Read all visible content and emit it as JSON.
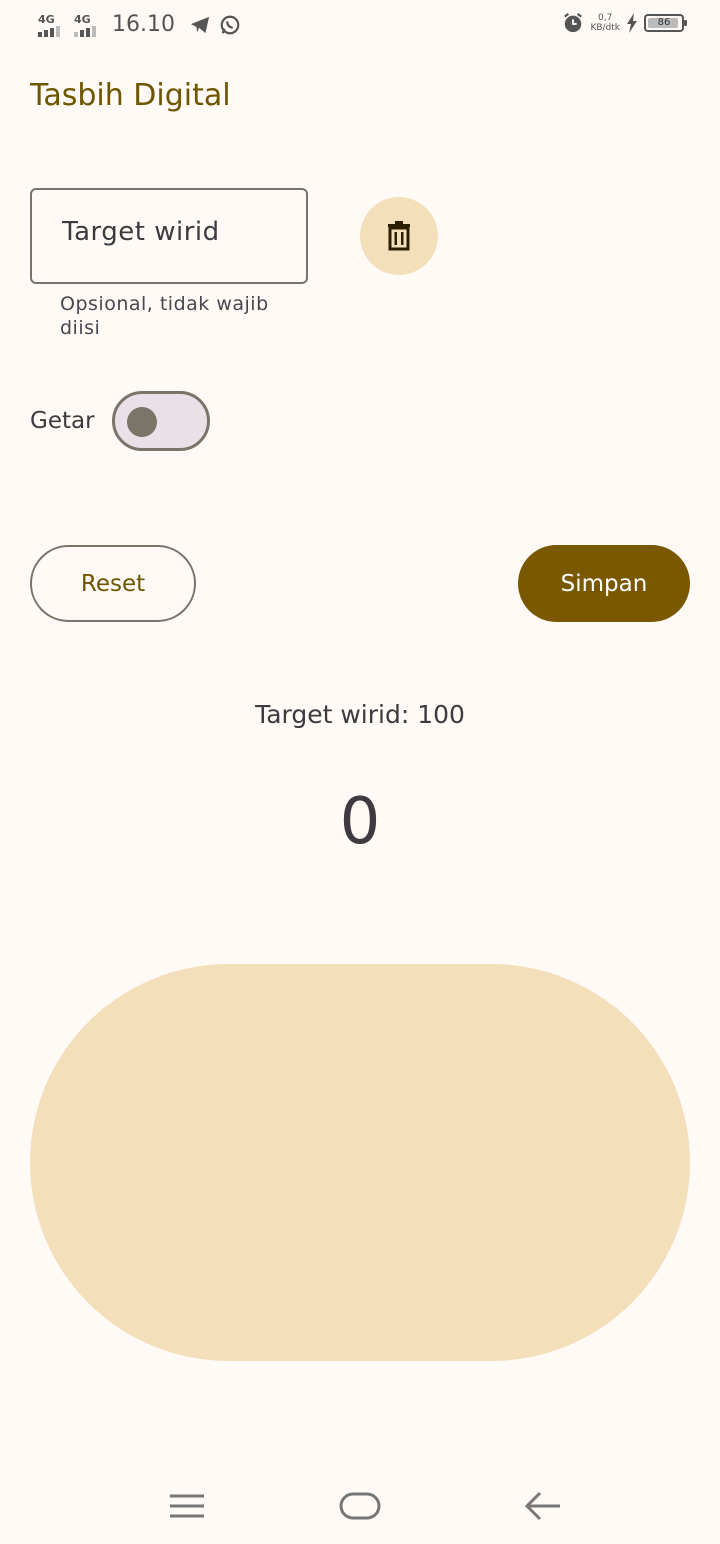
{
  "status_bar": {
    "network_1": "4G",
    "network_2": "4G",
    "time": "16.10",
    "speed_value": "0,7",
    "speed_unit": "KB/dtk",
    "battery": "86",
    "icons": [
      "telegram-icon",
      "whatsapp-icon",
      "alarm-icon",
      "charging-icon"
    ]
  },
  "app": {
    "title": "Tasbih Digital"
  },
  "form": {
    "target_placeholder": "Target wirid",
    "target_value": "",
    "helper_text": "Opsional, tidak wajib diisi",
    "vibrate_label": "Getar",
    "vibrate_on": false
  },
  "actions": {
    "reset_label": "Reset",
    "save_label": "Simpan"
  },
  "counter": {
    "target_text": "Target wirid: 100",
    "count": "0"
  },
  "colors": {
    "primary": "#7a5800",
    "title": "#6e5500",
    "tonal": "#f4dfbb",
    "background": "#fffaf5"
  },
  "nav": {
    "items": [
      "menu-icon",
      "home-icon",
      "back-icon"
    ]
  }
}
